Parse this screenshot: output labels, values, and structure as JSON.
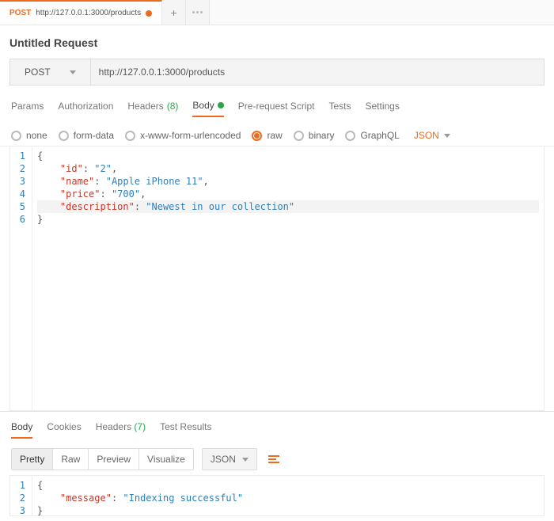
{
  "tabbar": {
    "tabs": [
      {
        "method": "POST",
        "title": "http://127.0.0.1:3000/products",
        "dirty": true
      }
    ]
  },
  "request": {
    "title": "Untitled Request",
    "method": "POST",
    "url": "http://127.0.0.1:3000/products",
    "tabs": {
      "params": "Params",
      "authorization": "Authorization",
      "headers_label": "Headers",
      "headers_count": "(8)",
      "body": "Body",
      "prerequest": "Pre-request Script",
      "tests": "Tests",
      "settings": "Settings"
    },
    "body_types": {
      "none": "none",
      "form_data": "form-data",
      "urlencoded": "x-www-form-urlencoded",
      "raw": "raw",
      "binary": "binary",
      "graphql": "GraphQL",
      "json": "JSON"
    },
    "body_json": {
      "id_key": "\"id\"",
      "id_val": "\"2\"",
      "name_key": "\"name\"",
      "name_val": "\"Apple iPhone 11\"",
      "price_key": "\"price\"",
      "price_val": "\"700\"",
      "desc_key": "\"description\"",
      "desc_val": "\"Newest in our collection\""
    }
  },
  "response": {
    "tabs": {
      "body": "Body",
      "cookies": "Cookies",
      "headers_label": "Headers",
      "headers_count": "(7)",
      "test_results": "Test Results"
    },
    "views": {
      "pretty": "Pretty",
      "raw": "Raw",
      "preview": "Preview",
      "visualize": "Visualize"
    },
    "format_dd": "JSON",
    "body_json": {
      "msg_key": "\"message\"",
      "msg_val": "\"Indexing successful\""
    }
  }
}
